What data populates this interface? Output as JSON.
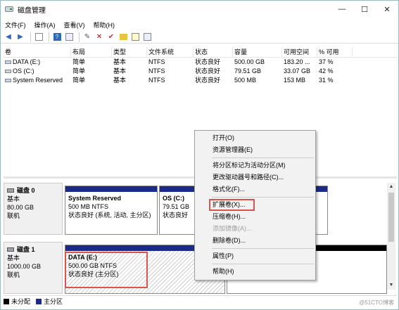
{
  "window": {
    "title": "磁盘管理",
    "controls": {
      "minimize": "—",
      "maximize": "☐",
      "close": "✕"
    }
  },
  "menubar": {
    "items": [
      "文件(F)",
      "操作(A)",
      "查看(V)",
      "帮助(H)"
    ]
  },
  "toolbar": {
    "icons": [
      "back-arrow-icon",
      "forward-arrow-icon",
      "list-icon",
      "help-icon",
      "properties-icon",
      "connect-icon",
      "delete-icon",
      "check-icon",
      "folder-up-icon",
      "view-icon",
      "properties-box-icon"
    ]
  },
  "volume_list": {
    "columns": [
      "卷",
      "布局",
      "类型",
      "文件系统",
      "状态",
      "容量",
      "可用空间",
      "% 可用"
    ],
    "rows": [
      [
        "DATA (E:)",
        "简单",
        "基本",
        "NTFS",
        "状态良好",
        "500.00 GB",
        "183.20 ...",
        "37 %"
      ],
      [
        "OS (C:)",
        "简单",
        "基本",
        "NTFS",
        "状态良好",
        "79.51 GB",
        "33.07 GB",
        "42 %"
      ],
      [
        "System Reserved",
        "简单",
        "基本",
        "NTFS",
        "状态良好",
        "500 MB",
        "153 MB",
        "31 %"
      ]
    ]
  },
  "disks": [
    {
      "name": "磁盘 0",
      "type": "基本",
      "size": "80.00 GB",
      "state": "联机",
      "partitions": [
        {
          "name": "System Reserved",
          "size": "500 MB NTFS",
          "status": "状态良好 (系统, 活动, 主分区)"
        },
        {
          "name": "OS  (C:)",
          "size": "79.51 GB",
          "status": "状态良好"
        }
      ]
    },
    {
      "name": "磁盘 1",
      "type": "基本",
      "size": "1000.00 GB",
      "state": "联机",
      "partitions": [
        {
          "name": "DATA  (E:)",
          "size": "500.00 GB NTFS",
          "status": "状态良好 (主分区)"
        },
        {
          "name": "",
          "size": "",
          "status": "未分配"
        }
      ]
    }
  ],
  "legend": [
    {
      "label": "未分配",
      "color": "#000000"
    },
    {
      "label": "主分区",
      "color": "#1a2a8a"
    }
  ],
  "context_menu": {
    "items": [
      {
        "label": "打开(O)",
        "enabled": true
      },
      {
        "label": "资源管理器(E)",
        "enabled": true
      },
      {
        "sep": true
      },
      {
        "label": "将分区标记为活动分区(M)",
        "enabled": true
      },
      {
        "label": "更改驱动器号和路径(C)...",
        "enabled": true
      },
      {
        "label": "格式化(F)...",
        "enabled": true
      },
      {
        "sep": true
      },
      {
        "label": "扩展卷(X)...",
        "enabled": true
      },
      {
        "label": "压缩卷(H)...",
        "enabled": true
      },
      {
        "label": "添加镜像(A)...",
        "enabled": false
      },
      {
        "label": "删除卷(D)...",
        "enabled": true
      },
      {
        "sep": true
      },
      {
        "label": "属性(P)",
        "enabled": true
      },
      {
        "sep": true
      },
      {
        "label": "帮助(H)",
        "enabled": true
      }
    ]
  },
  "colors": {
    "primary_partition": "#1a2a8a",
    "unallocated": "#000000",
    "highlight": "#d9534f"
  },
  "watermark": "@51CTO博客"
}
